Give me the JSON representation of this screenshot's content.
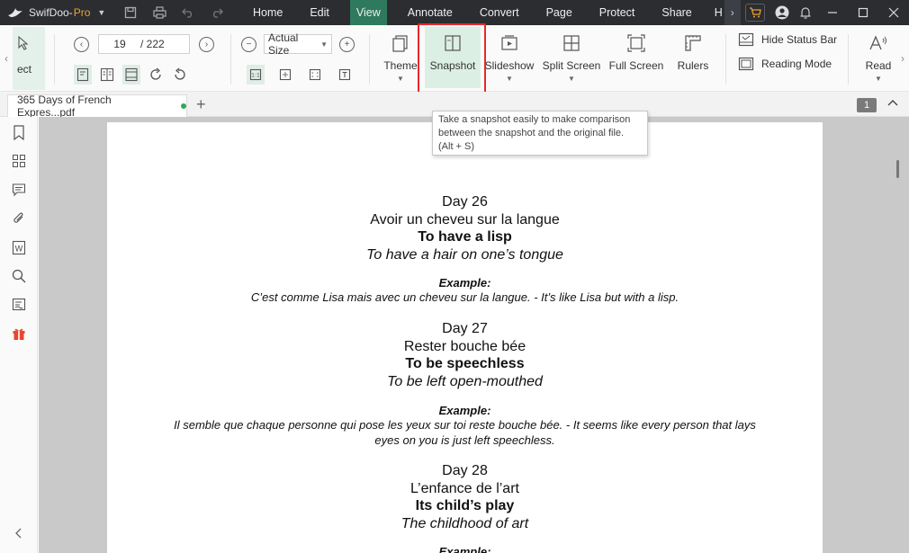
{
  "titlebar": {
    "app_name": "SwifDoo-",
    "app_suffix": "Pro",
    "menu": [
      {
        "label": "Home"
      },
      {
        "label": "Edit"
      },
      {
        "label": "View"
      },
      {
        "label": "Annotate"
      },
      {
        "label": "Convert"
      },
      {
        "label": "Page"
      },
      {
        "label": "Protect"
      },
      {
        "label": "Share"
      },
      {
        "label": "H"
      }
    ],
    "active_menu": "View"
  },
  "ribbon": {
    "select_label": "ect",
    "current_page": "19",
    "total_pages": "/ 222",
    "zoom": "Actual Size",
    "buttons": {
      "theme": "Theme",
      "snapshot": "Snapshot",
      "slideshow": "Slideshow",
      "split_screen": "Split Screen",
      "full_screen": "Full Screen",
      "rulers": "Rulers",
      "read": "Read"
    },
    "hide_status_bar": "Hide Status Bar",
    "reading_mode": "Reading Mode"
  },
  "tabs": {
    "doc_tab": "365 Days of French Expres...pdf",
    "page_badge": "1"
  },
  "tooltip": {
    "line1": "Take a snapshot easily to make comparison",
    "line2": "between the snapshot and the original file.",
    "line3": "(Alt + S)"
  },
  "document": {
    "entries": [
      {
        "day": "Day 26",
        "french": "Avoir un cheveu sur la langue",
        "english": "To have a lisp",
        "literal": "To have a hair on one’s tongue",
        "example_heading": "Example:",
        "example_lines": [
          "C’est comme Lisa mais avec un cheveu sur la langue. - It’s like Lisa but with a lisp."
        ]
      },
      {
        "day": "Day 27",
        "french": "Rester bouche bée",
        "english": "To be speechless",
        "literal": "To be left open-mouthed",
        "example_heading": "Example:",
        "example_lines": [
          "Il semble que chaque personne qui pose les yeux sur toi reste bouche bée. -  It seems like every person that lays",
          "eyes on you is just left speechless."
        ]
      },
      {
        "day": "Day 28",
        "french": "L’enfance de l’art",
        "english": "Its child’s play",
        "literal": "The childhood of art",
        "example_heading": "Example:",
        "example_lines": []
      }
    ]
  },
  "colors": {
    "titlebar_bg": "#2b2d31",
    "active_menu_bg": "#2f7a5e",
    "accent_green": "#2ea65b",
    "highlight_red": "#e8282b",
    "logo_orange": "#f0a030"
  }
}
